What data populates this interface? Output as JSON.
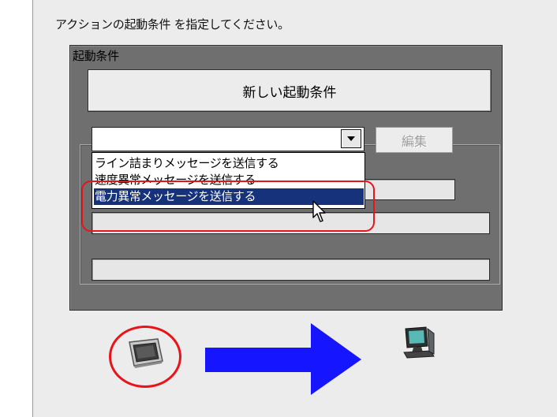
{
  "instruction": "アクションの起動条件 を指定してください。",
  "group": {
    "title": "起動条件",
    "new_button_label": "新しい起動条件",
    "edit_button_label": "編集",
    "combo_value": ""
  },
  "dropdown": {
    "items": [
      "ライン詰まりメッセージを送信する",
      "速度異常メッセージを送信する",
      "電力異常メッセージを送信する"
    ],
    "selected_index": 2
  },
  "icons": {
    "touch_panel": "touch-panel-icon",
    "flow_arrow": "right-arrow-icon",
    "pc": "pc-icon"
  },
  "colors": {
    "highlight_red": "#e8141a",
    "selection_blue": "#16327a",
    "arrow_blue": "#1515ff"
  }
}
